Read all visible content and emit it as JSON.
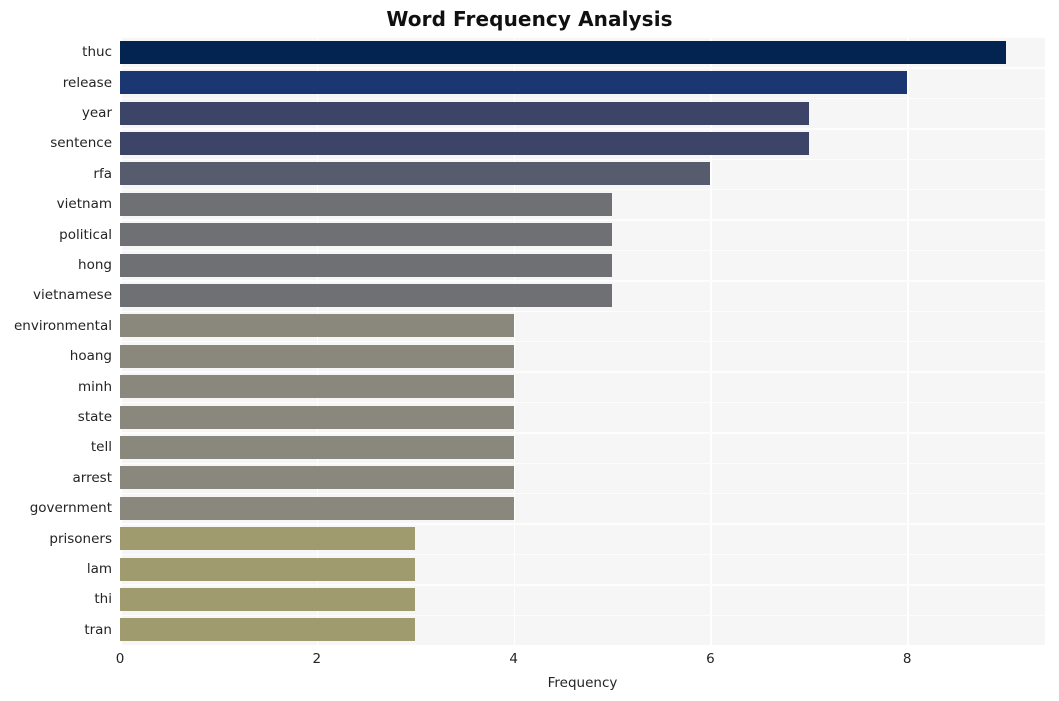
{
  "chart_data": {
    "type": "bar",
    "orientation": "horizontal",
    "title": "Word Frequency Analysis",
    "xlabel": "Frequency",
    "ylabel": "",
    "categories": [
      "thuc",
      "release",
      "year",
      "sentence",
      "rfa",
      "vietnam",
      "political",
      "hong",
      "vietnamese",
      "environmental",
      "hoang",
      "minh",
      "state",
      "tell",
      "arrest",
      "government",
      "prisoners",
      "lam",
      "thi",
      "tran"
    ],
    "values": [
      9,
      8,
      7,
      7,
      6,
      5,
      5,
      5,
      5,
      4,
      4,
      4,
      4,
      4,
      4,
      4,
      3,
      3,
      3,
      3
    ],
    "bar_colors": [
      "#032450",
      "#1a3771",
      "#3c4568",
      "#3c4568",
      "#575b6e",
      "#6e7073",
      "#6e7073",
      "#6e7073",
      "#6e7073",
      "#8a887c",
      "#8a887c",
      "#8a887c",
      "#8a887c",
      "#8a887c",
      "#8a887c",
      "#8a887c",
      "#a09a6f",
      "#a09a6f",
      "#a09a6f",
      "#a09a6f"
    ],
    "xlim": [
      0,
      9.4
    ],
    "x_ticks": [
      "0",
      "2",
      "4",
      "6",
      "8"
    ],
    "x_tick_values": [
      0,
      2,
      4,
      6,
      8
    ],
    "grid": true,
    "grid_color": "#ffffff",
    "plot_background": "#f6f6f7",
    "figure_background": "#ffffff",
    "legend": null,
    "legend_position": "none"
  }
}
